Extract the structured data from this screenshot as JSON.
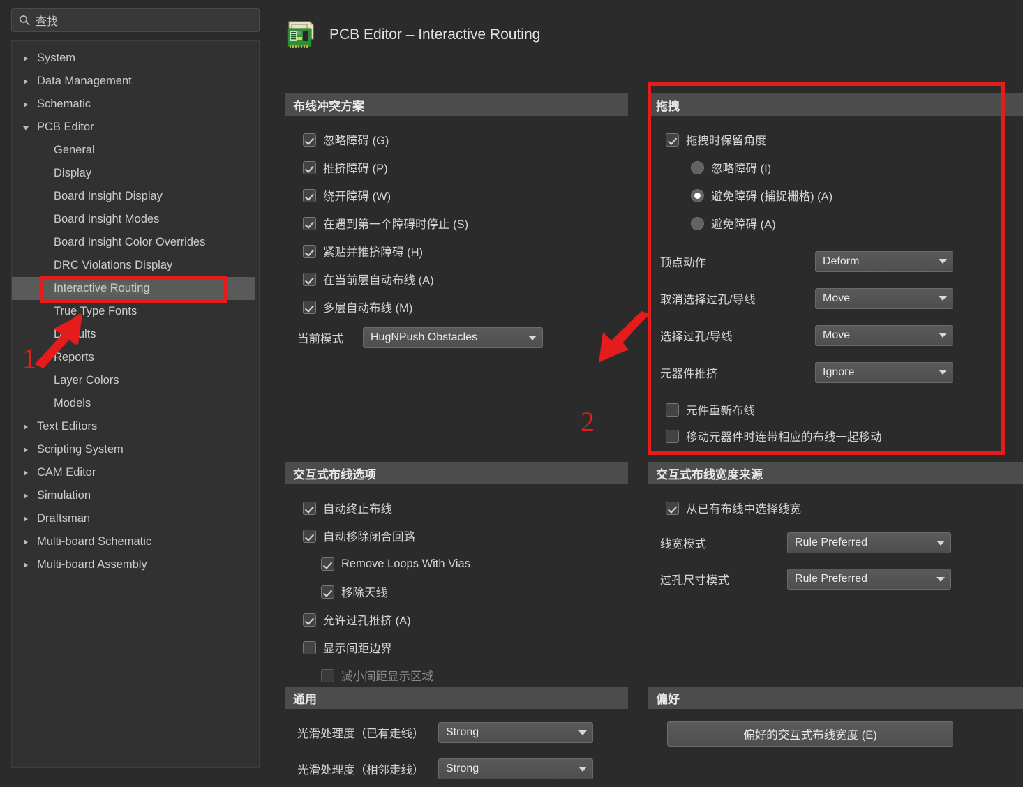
{
  "search": {
    "placeholder": "查找",
    "value": "查找",
    "icon": "search-icon"
  },
  "tree": {
    "items": [
      {
        "label": "System",
        "level": 1,
        "expander": "collapsed",
        "selected": false
      },
      {
        "label": "Data Management",
        "level": 1,
        "expander": "collapsed",
        "selected": false
      },
      {
        "label": "Schematic",
        "level": 1,
        "expander": "collapsed",
        "selected": false
      },
      {
        "label": "PCB Editor",
        "level": 1,
        "expander": "expanded",
        "selected": false
      },
      {
        "label": "General",
        "level": 2,
        "expander": "none",
        "selected": false
      },
      {
        "label": "Display",
        "level": 2,
        "expander": "none",
        "selected": false
      },
      {
        "label": "Board Insight Display",
        "level": 2,
        "expander": "none",
        "selected": false
      },
      {
        "label": "Board Insight Modes",
        "level": 2,
        "expander": "none",
        "selected": false
      },
      {
        "label": "Board Insight Color Overrides",
        "level": 2,
        "expander": "none",
        "selected": false
      },
      {
        "label": "DRC Violations Display",
        "level": 2,
        "expander": "none",
        "selected": false
      },
      {
        "label": "Interactive Routing",
        "level": 2,
        "expander": "none",
        "selected": true
      },
      {
        "label": "True Type Fonts",
        "level": 2,
        "expander": "none",
        "selected": false
      },
      {
        "label": "Defaults",
        "level": 2,
        "expander": "none",
        "selected": false
      },
      {
        "label": "Reports",
        "level": 2,
        "expander": "none",
        "selected": false
      },
      {
        "label": "Layer Colors",
        "level": 2,
        "expander": "none",
        "selected": false
      },
      {
        "label": "Models",
        "level": 2,
        "expander": "none",
        "selected": false
      },
      {
        "label": "Text Editors",
        "level": 1,
        "expander": "collapsed",
        "selected": false
      },
      {
        "label": "Scripting System",
        "level": 1,
        "expander": "collapsed",
        "selected": false
      },
      {
        "label": "CAM Editor",
        "level": 1,
        "expander": "collapsed",
        "selected": false
      },
      {
        "label": "Simulation",
        "level": 1,
        "expander": "collapsed",
        "selected": false
      },
      {
        "label": "Draftsman",
        "level": 1,
        "expander": "collapsed",
        "selected": false
      },
      {
        "label": "Multi-board Schematic",
        "level": 1,
        "expander": "collapsed",
        "selected": false
      },
      {
        "label": "Multi-board Assembly",
        "level": 1,
        "expander": "collapsed",
        "selected": false
      }
    ]
  },
  "header": {
    "title": "PCB Editor – Interactive Routing",
    "icon": "pcb-board-icon"
  },
  "sections": {
    "routing_conflict": {
      "title": "布线冲突方案",
      "checkboxes": [
        {
          "label": "忽略障碍 (G)",
          "accel": "G",
          "checked": true
        },
        {
          "label": "推挤障碍 (P)",
          "accel": "P",
          "checked": true
        },
        {
          "label": "绕开障碍 (W)",
          "accel": "W",
          "checked": true
        },
        {
          "label": "在遇到第一个障碍时停止 (S)",
          "accel": "S",
          "checked": true
        },
        {
          "label": "紧贴并推挤障碍 (H)",
          "accel": "H",
          "checked": true
        },
        {
          "label": "在当前层自动布线 (A)",
          "accel": "A",
          "checked": true
        },
        {
          "label": "多层自动布线 (M)",
          "accel": "M",
          "checked": true
        }
      ],
      "current_mode": {
        "label": "当前模式",
        "value": "HugNPush Obstacles"
      }
    },
    "dragging": {
      "title": "拖拽",
      "preserve_angle": {
        "label": "拖拽时保留角度",
        "checked": true
      },
      "radios": [
        {
          "label": "忽略障碍 (I)",
          "accel": "I",
          "selected": false
        },
        {
          "label": "避免障碍 (捕捉栅格) (A)",
          "accel": "A",
          "selected": true
        },
        {
          "label": "避免障碍 (A)",
          "accel": "A",
          "selected": false
        }
      ],
      "dropdowns": [
        {
          "label": "顶点动作",
          "value": "Deform"
        },
        {
          "label": "取消选择过孔/导线",
          "value": "Move"
        },
        {
          "label": "选择过孔/导线",
          "value": "Move"
        },
        {
          "label": "元器件推挤",
          "value": "Ignore"
        }
      ],
      "checkboxes": [
        {
          "label": "元件重新布线",
          "checked": false
        },
        {
          "label": "移动元器件时连带相应的布线一起移动",
          "checked": false
        }
      ]
    },
    "interactive_routing_options": {
      "title": "交互式布线选项",
      "checkboxes": [
        {
          "label": "自动终止布线",
          "checked": true,
          "indent": 0,
          "disabled": false
        },
        {
          "label": "自动移除闭合回路",
          "checked": true,
          "indent": 0,
          "disabled": false
        },
        {
          "label": "Remove Loops With Vias",
          "checked": true,
          "indent": 1,
          "disabled": false
        },
        {
          "label": "移除天线",
          "checked": true,
          "indent": 1,
          "disabled": false
        },
        {
          "label": "允许过孔推挤 (A)",
          "accel": "A",
          "checked": true,
          "indent": 0,
          "disabled": false
        },
        {
          "label": "显示间距边界",
          "checked": false,
          "indent": 0,
          "disabled": false
        },
        {
          "label": "减小间距显示区域",
          "checked": false,
          "indent": 1,
          "disabled": true
        }
      ]
    },
    "width_source": {
      "title": "交互式布线宽度来源",
      "checkbox": {
        "label": "从已有布线中选择线宽",
        "checked": true
      },
      "dropdowns": [
        {
          "label": "线宽模式",
          "value": "Rule Preferred"
        },
        {
          "label": "过孔尺寸模式",
          "value": "Rule Preferred"
        }
      ]
    },
    "general": {
      "title": "通用",
      "dropdowns": [
        {
          "label": "光滑处理度（已有走线）",
          "value": "Strong"
        },
        {
          "label": "光滑处理度（相邻走线）",
          "value": "Strong"
        }
      ]
    },
    "preferences": {
      "title": "偏好",
      "button": {
        "label": "偏好的交互式布线宽度 (E)",
        "accel": "E"
      }
    }
  },
  "annotations": {
    "accent_color": "#e51c1c",
    "marks": [
      {
        "number": "1",
        "target": "Interactive Routing tree item"
      },
      {
        "number": "2",
        "target": "拖拽 section"
      }
    ]
  }
}
